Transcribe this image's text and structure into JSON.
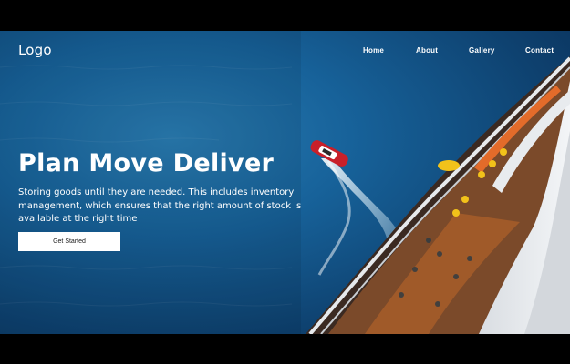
{
  "nav": {
    "logo": "Logo",
    "links": [
      "Home",
      "About",
      "Gallery",
      "Contact"
    ]
  },
  "hero": {
    "headline": "Plan Move Deliver",
    "subtext": "Storing goods until they are needed. This includes inventory management, which ensures that the right amount of stock is available at the right time",
    "cta_label": "Get Started"
  },
  "colors": {
    "sea_dark": "#0b3159",
    "sea_light": "#1f6fa6",
    "text": "#ffffff",
    "button_bg": "#ffffff",
    "button_text": "#1b1b1b"
  }
}
